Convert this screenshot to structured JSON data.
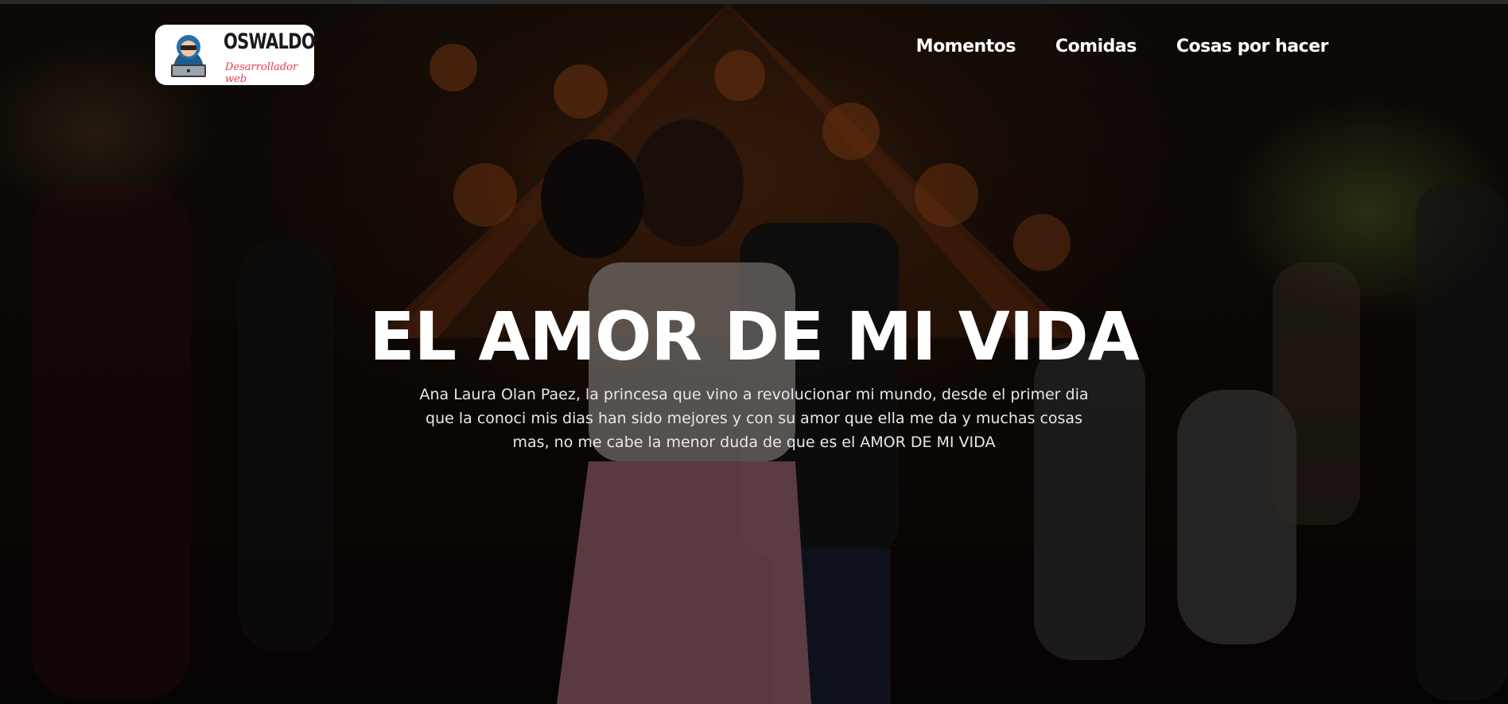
{
  "header": {
    "logo": {
      "name": "OSWALDO",
      "tagline": "Desarrollador web"
    },
    "nav": [
      {
        "label": "Momentos"
      },
      {
        "label": "Comidas"
      },
      {
        "label": "Cosas por hacer"
      }
    ]
  },
  "hero": {
    "title": "EL AMOR DE MI VIDA",
    "description": "Ana Laura Olan Paez, la princesa que vino a revolucionar mi mundo, desde el primer dia que la conoci mis dias han sido mejores y con su amor que ella me da y muchas cosas mas, no me cabe la menor duda de que es el AMOR DE MI VIDA",
    "background_image": "couple-kissing-night-christmas-tree-photo"
  },
  "colors": {
    "logo_accent": "#e5394f",
    "text": "#ffffff"
  }
}
